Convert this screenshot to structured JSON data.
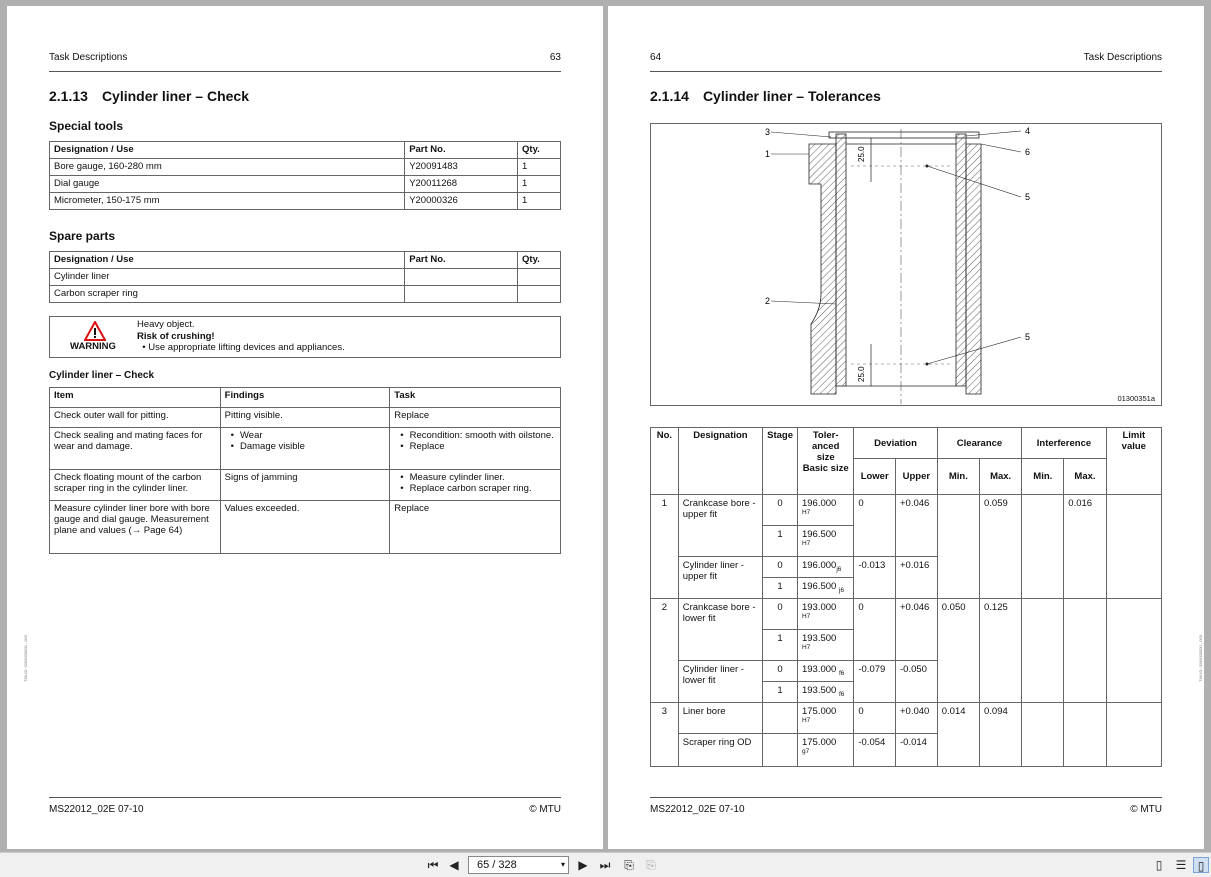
{
  "left_page": {
    "header_left": "Task Descriptions",
    "header_right": "63",
    "section_num": "2.1.13",
    "section_title": "Cylinder liner – Check",
    "special_tools_heading": "Special tools",
    "tools_headers": [
      "Designation / Use",
      "Part No.",
      "Qty."
    ],
    "tools": [
      [
        "Bore gauge, 160-280 mm",
        "Y20091483",
        "1"
      ],
      [
        "Dial gauge",
        "Y20011268",
        "1"
      ],
      [
        "Micrometer, 150-175 mm",
        "Y20000326",
        "1"
      ]
    ],
    "spare_parts_heading": "Spare parts",
    "spare_headers": [
      "Designation / Use",
      "Part No.",
      "Qty."
    ],
    "spare": [
      [
        "Cylinder liner",
        "",
        ""
      ],
      [
        "Carbon scraper ring",
        "",
        ""
      ]
    ],
    "warning": {
      "label": "WARNING",
      "line1": "Heavy object.",
      "line2": "Risk of crushing!",
      "bullet": "Use appropriate lifting devices and appliances."
    },
    "check_heading": "Cylinder liner – Check",
    "check_headers": [
      "Item",
      "Findings",
      "Task"
    ],
    "check_rows": [
      {
        "item": "Check outer wall for pitting.",
        "findings": "Pitting visible.",
        "task": "Replace"
      },
      {
        "item": "Check sealing and mating faces for wear and damage.",
        "findings_list": [
          "Wear",
          "Damage visible"
        ],
        "task_list": [
          "Recondition: smooth with oilstone.",
          "Replace"
        ]
      },
      {
        "item": "Check floating mount of the carbon scraper ring in the cylinder liner.",
        "findings": "Signs of jamming",
        "task_list": [
          "Measure cylinder liner.",
          "Replace carbon scraper ring."
        ]
      },
      {
        "item": "Measure cylinder liner bore with bore gauge and dial gauge. Measurement plane and values (→ Page 64)",
        "findings": "Values exceeded.",
        "task": "Replace"
      }
    ],
    "footer_left": "MS22012_02E   07-10",
    "footer_right": "© MTU",
    "side_note": "TIM-ID: 0000000000 - 003"
  },
  "right_page": {
    "header_left": "64",
    "header_right": "Task Descriptions",
    "section_num": "2.1.14",
    "section_title": "Cylinder liner – Tolerances",
    "figure": {
      "id": "01300351a",
      "callouts": [
        "1",
        "2",
        "3",
        "4",
        "5",
        "5",
        "6"
      ],
      "dims": [
        "25.0",
        "25.0"
      ]
    },
    "tol_headers": {
      "no": "No.",
      "designation": "Designation",
      "stage": "Stage",
      "tol_size": "Toler-anced size",
      "basic_size": "Basic size",
      "deviation": "Deviation",
      "lower": "Lower",
      "upper": "Upper",
      "clearance": "Clearance",
      "interference": "Interference",
      "min": "Min.",
      "max": "Max.",
      "limit": "Limit value"
    },
    "tol_rows": [
      {
        "no": "1",
        "designation": "Crankcase bore - upper fit",
        "stage": "0",
        "size": "196.000",
        "fit": "H7",
        "lower": "0",
        "upper": "+0.046",
        "c_min": "",
        "c_max": "0.059",
        "i_min": "",
        "i_max": "0.016"
      },
      {
        "stage": "1",
        "size": "196.500",
        "fit": "H7"
      },
      {
        "designation": "Cylinder liner - upper fit",
        "stage": "0",
        "size": "196.000",
        "fit": "j6",
        "lower": "-0.013",
        "upper": "+0.016"
      },
      {
        "stage": "1",
        "size": "196.500",
        "fit": "j6"
      },
      {
        "no": "2",
        "designation": "Crankcase bore - lower fit",
        "stage": "0",
        "size": "193.000",
        "fit": "H7",
        "lower": "0",
        "upper": "+0.046",
        "c_min": "0.050",
        "c_max": "0.125"
      },
      {
        "stage": "1",
        "size": "193.500",
        "fit": "H7"
      },
      {
        "designation": "Cylinder liner - lower fit",
        "stage": "0",
        "size": "193.000",
        "fit": "f6",
        "lower": "-0.079",
        "upper": "-0.050"
      },
      {
        "stage": "1",
        "size": "193.500",
        "fit": "f6"
      },
      {
        "no": "3",
        "designation": "Liner bore",
        "size": "175.000",
        "fit": "H7",
        "lower": "0",
        "upper": "+0.040",
        "c_min": "0.014",
        "c_max": "0.094"
      },
      {
        "designation": "Scraper ring OD",
        "size": "175.000",
        "fit": "g7",
        "lower": "-0.054",
        "upper": "-0.014"
      }
    ],
    "footer_left": "MS22012_02E   07-10",
    "footer_right": "© MTU",
    "side_note": "TIM-ID: 0000000000 - 003"
  },
  "toolbar": {
    "page_indicator": "65 / 328"
  }
}
